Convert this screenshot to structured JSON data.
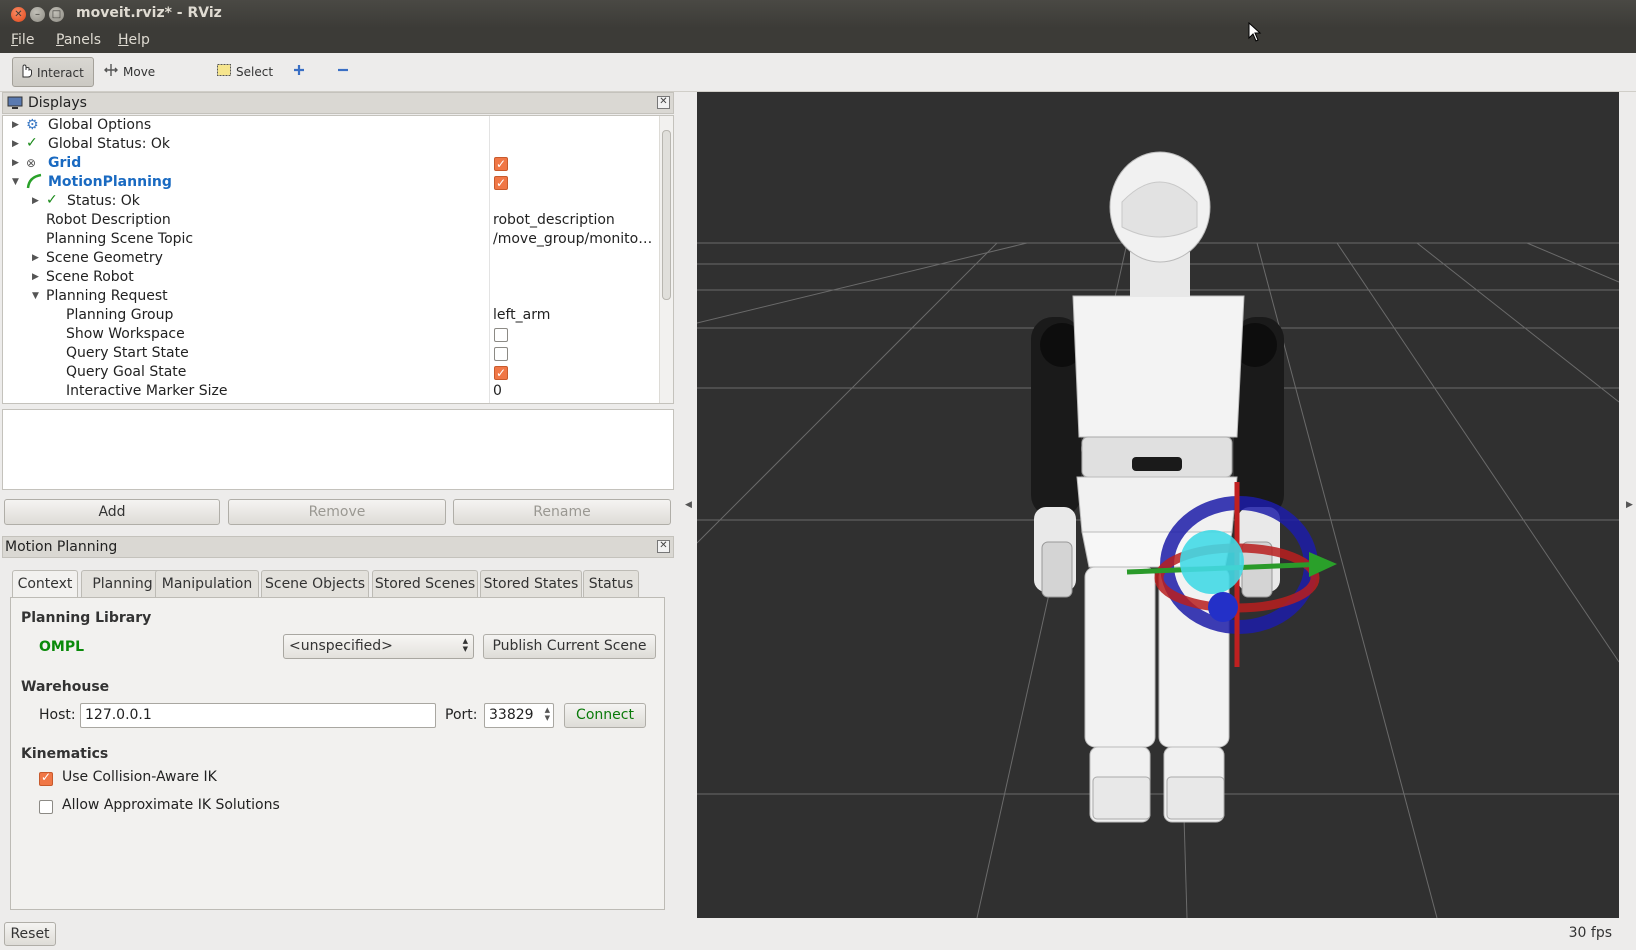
{
  "window": {
    "title": "moveit.rviz* - RViz"
  },
  "menu": [
    "File",
    "Panels",
    "Help"
  ],
  "toolbar": {
    "interact": "Interact",
    "move_camera": "Move Camera",
    "select": "Select"
  },
  "displays": {
    "title": "Displays",
    "rows": [
      {
        "label": "Global Options",
        "value": ""
      },
      {
        "label": "Global Status: Ok",
        "value": ""
      },
      {
        "label": "Grid",
        "value": ""
      },
      {
        "label": "MotionPlanning",
        "value": ""
      },
      {
        "label": "Status: Ok",
        "value": ""
      },
      {
        "label": "Robot Description",
        "value": "robot_description"
      },
      {
        "label": "Planning Scene Topic",
        "value": "/move_group/monito…"
      },
      {
        "label": "Scene Geometry",
        "value": ""
      },
      {
        "label": "Scene Robot",
        "value": ""
      },
      {
        "label": "Planning Request",
        "value": ""
      },
      {
        "label": "Planning Group",
        "value": "left_arm"
      },
      {
        "label": "Show Workspace",
        "value": ""
      },
      {
        "label": "Query Start State",
        "value": ""
      },
      {
        "label": "Query Goal State",
        "value": ""
      },
      {
        "label": "Interactive Marker Size",
        "value": "0"
      }
    ],
    "checked": {
      "grid": true,
      "motion_planning": true,
      "show_workspace": false,
      "query_start_state": false,
      "query_goal_state": true
    },
    "buttons": {
      "add": "Add",
      "remove": "Remove",
      "rename": "Rename"
    }
  },
  "motion_planning": {
    "title": "Motion Planning",
    "tabs": [
      "Context",
      "Planning",
      "Manipulation",
      "Scene Objects",
      "Stored Scenes",
      "Stored States",
      "Status"
    ],
    "active_tab": "Context",
    "planning_library": {
      "heading": "Planning Library",
      "library": "OMPL",
      "planner": "<unspecified>",
      "publish_button": "Publish Current Scene"
    },
    "warehouse": {
      "heading": "Warehouse",
      "host_label": "Host:",
      "host": "127.0.0.1",
      "port_label": "Port:",
      "port": "33829",
      "connect_button": "Connect"
    },
    "kinematics": {
      "heading": "Kinematics",
      "collision_aware_ik": "Use Collision-Aware IK",
      "collision_aware_ik_checked": true,
      "approximate_ik": "Allow Approximate IK Solutions",
      "approximate_ik_checked": false
    }
  },
  "statusbar": {
    "reset": "Reset",
    "fps": "30 fps"
  },
  "colors": {
    "accent_link": "#1a6ac1",
    "ok_green": "#0a8a0a",
    "checkbox_orange": "#f07746",
    "viewport_bg": "#303030"
  }
}
